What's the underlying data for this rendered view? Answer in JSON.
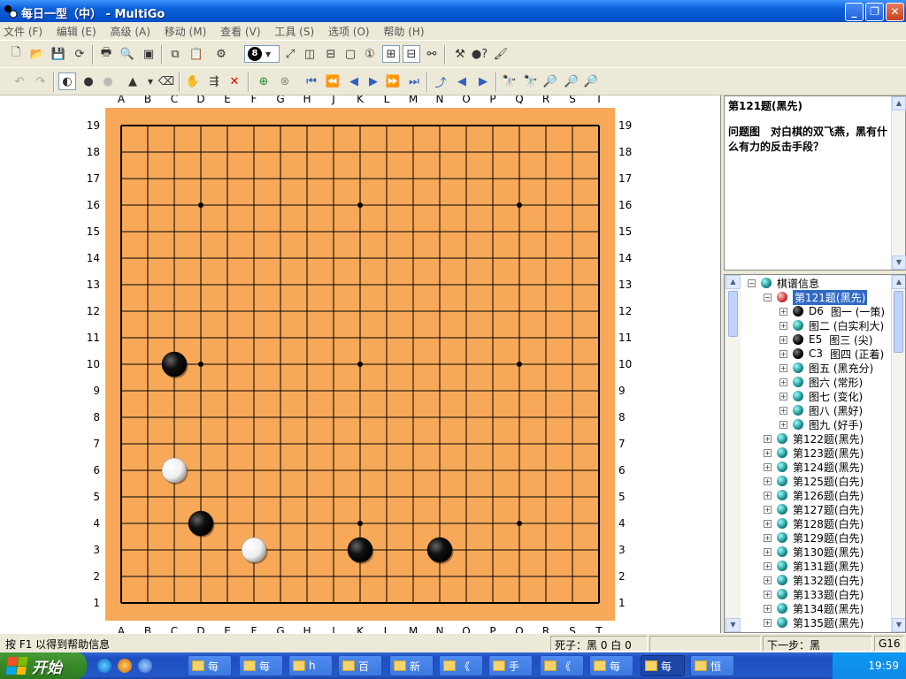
{
  "window": {
    "title": "每日一型（中） - MultiGo"
  },
  "menu": [
    "文件 (F)",
    "编辑 (E)",
    "高级 (A)",
    "移动 (M)",
    "查看 (V)",
    "工具 (S)",
    "选项 (O)",
    "帮助 (H)"
  ],
  "toolbar": {
    "move_number": "8"
  },
  "board": {
    "size": 19,
    "columns": [
      "A",
      "B",
      "C",
      "D",
      "E",
      "F",
      "G",
      "H",
      "J",
      "K",
      "L",
      "M",
      "N",
      "O",
      "P",
      "Q",
      "R",
      "S",
      "T"
    ],
    "rows": [
      "19",
      "18",
      "17",
      "16",
      "15",
      "14",
      "13",
      "12",
      "11",
      "10",
      "9",
      "8",
      "7",
      "6",
      "5",
      "4",
      "3",
      "2",
      "1"
    ],
    "board_color": "#f7a859",
    "star_points": [
      "D16",
      "K16",
      "Q16",
      "D10",
      "K10",
      "Q10",
      "D4",
      "K4",
      "Q4"
    ],
    "stones": [
      {
        "color": "black",
        "point": "C10"
      },
      {
        "color": "white",
        "point": "C6"
      },
      {
        "color": "black",
        "point": "D4"
      },
      {
        "color": "white",
        "point": "F3"
      },
      {
        "color": "black",
        "point": "K3"
      },
      {
        "color": "black",
        "point": "N3"
      }
    ]
  },
  "problem": {
    "title": "第121题(黑先)",
    "description": "问题图　对白棋的双飞燕，黑有什么有力的反击手段？"
  },
  "tree": {
    "root": "棋谱信息",
    "selected": "第121题(黑先)",
    "variations": [
      {
        "coord": "D6",
        "label": "图一 (一策)",
        "ball": "black"
      },
      {
        "coord": "",
        "label": "图二 (白实利大)",
        "ball": "teal"
      },
      {
        "coord": "E5",
        "label": "图三 (尖)",
        "ball": "black"
      },
      {
        "coord": "C3",
        "label": "图四 (正着)",
        "ball": "black"
      },
      {
        "coord": "",
        "label": "图五 (黑充分)",
        "ball": "teal"
      },
      {
        "coord": "",
        "label": "图六 (常形)",
        "ball": "teal"
      },
      {
        "coord": "",
        "label": "图七 (变化)",
        "ball": "teal"
      },
      {
        "coord": "",
        "label": "图八 (黑好)",
        "ball": "teal"
      },
      {
        "coord": "",
        "label": "图九 (好手)",
        "ball": "teal"
      }
    ],
    "problems": [
      "第122题(黑先)",
      "第123题(黑先)",
      "第124题(黑先)",
      "第125题(白先)",
      "第126题(白先)",
      "第127题(白先)",
      "第128题(白先)",
      "第129题(白先)",
      "第130题(黑先)",
      "第131题(黑先)",
      "第132题(白先)",
      "第133题(白先)",
      "第134题(黑先)",
      "第135题(黑先)"
    ]
  },
  "status": {
    "help": "按 F1 以得到帮助信息",
    "captures": "死子：黑 0 白 0",
    "next": "下一步：黑",
    "move": "G16"
  },
  "taskbar": {
    "start": "开始",
    "buttons": [
      "每",
      "每",
      "h",
      "百",
      "新",
      "《",
      "手",
      "《",
      "每",
      "每",
      "恒"
    ],
    "clock": "19:59"
  }
}
